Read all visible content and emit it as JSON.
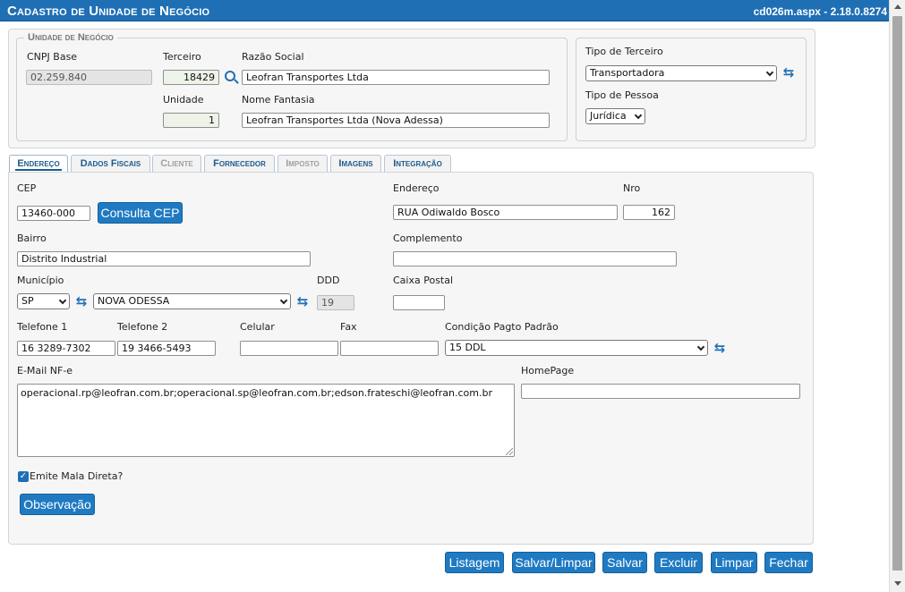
{
  "window": {
    "title": "Cadastro de Unidade de Negócio",
    "version": "cd026m.aspx - 2.18.0.8274"
  },
  "business_unit": {
    "legend": "Unidade de Negócio",
    "cnpj_base_label": "CNPJ Base",
    "cnpj_base_value": "02.259.840",
    "terceiro_label": "Terceiro",
    "terceiro_value": "18429",
    "razao_social_label": "Razão Social",
    "razao_social_value": "Leofran Transportes Ltda",
    "unidade_label": "Unidade",
    "unidade_value": "1",
    "nome_fantasia_label": "Nome Fantasia",
    "nome_fantasia_value": "Leofran Transportes Ltda (Nova Adessa)"
  },
  "third_party": {
    "tipo_terceiro_label": "Tipo de Terceiro",
    "tipo_terceiro_value": "Transportadora",
    "tipo_pessoa_label": "Tipo de Pessoa",
    "tipo_pessoa_value": "Jurídica"
  },
  "tabs": [
    {
      "label": "Endereço",
      "state": "active"
    },
    {
      "label": "Dados Fiscais",
      "state": "enabled"
    },
    {
      "label": "Cliente",
      "state": "disabled"
    },
    {
      "label": "Fornecedor",
      "state": "enabled"
    },
    {
      "label": "Imposto",
      "state": "disabled"
    },
    {
      "label": "Imagens",
      "state": "enabled"
    },
    {
      "label": "Integração",
      "state": "enabled"
    }
  ],
  "address": {
    "cep_label": "CEP",
    "cep_value": "13460-000",
    "consulta_cep_label": "Consulta CEP",
    "endereco_label": "Endereço",
    "endereco_value": "RUA Odiwaldo Bosco",
    "nro_label": "Nro",
    "nro_value": "162",
    "bairro_label": "Bairro",
    "bairro_value": "Distrito Industrial",
    "complemento_label": "Complemento",
    "complemento_value": "",
    "municipio_label": "Município",
    "uf_value": "SP",
    "municipio_value": "NOVA ODESSA",
    "ddd_label": "DDD",
    "ddd_value": "19",
    "caixa_postal_label": "Caixa Postal",
    "caixa_postal_value": "",
    "telefone1_label": "Telefone 1",
    "telefone1_value": "16 3289-7302",
    "telefone2_label": "Telefone 2",
    "telefone2_value": "19 3466-5493",
    "celular_label": "Celular",
    "celular_value": "",
    "fax_label": "Fax",
    "fax_value": "",
    "condicao_label": "Condição Pagto Padrão",
    "condicao_value": "15 DDL",
    "email_label": "E-Mail NF-e",
    "email_value": "operacional.rp@leofran.com.br;operacional.sp@leofran.com.br;edson.frateschi@leofran.com.br",
    "homepage_label": "HomePage",
    "homepage_value": "",
    "mala_direta_label": "Emite Mala Direta?",
    "mala_direta_checked": true,
    "observacao_label": "Observação"
  },
  "actions": {
    "listagem": "Listagem",
    "salvar_limpar": "Salvar/Limpar",
    "salvar": "Salvar",
    "excluir": "Excluir",
    "limpar": "Limpar",
    "fechar": "Fechar"
  },
  "icons": {
    "refresh": "refresh-icon",
    "search": "search-icon",
    "check": "check-icon"
  }
}
